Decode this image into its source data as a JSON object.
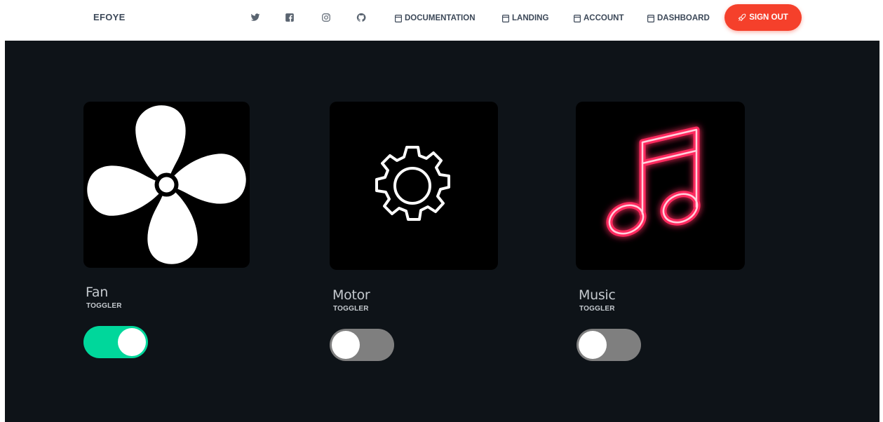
{
  "navbar": {
    "brand": "EFOYE",
    "social": [
      {
        "icon": "twitter-icon"
      },
      {
        "icon": "facebook-icon"
      },
      {
        "icon": "instagram-icon"
      },
      {
        "icon": "github-icon"
      }
    ],
    "links": [
      {
        "label": "DOCUMENTATION",
        "icon": "page-icon"
      },
      {
        "label": "LANDING",
        "icon": "page-icon"
      },
      {
        "label": "ACCOUNT",
        "icon": "page-icon"
      },
      {
        "label": "DASHBOARD",
        "icon": "page-icon"
      }
    ],
    "signout": {
      "label": "SIGN OUT",
      "icon": "rocket-icon",
      "color": "#f5402b"
    }
  },
  "devices": [
    {
      "name": "Fan",
      "subtitle": "TOGGLER",
      "icon": "fan-icon",
      "on": true
    },
    {
      "name": "Motor",
      "subtitle": "TOGGLER",
      "icon": "gear-icon",
      "on": false
    },
    {
      "name": "Music",
      "subtitle": "TOGGLER",
      "icon": "music-note-icon",
      "on": false
    }
  ],
  "colors": {
    "background": "#0e1318",
    "toggle_on": "#00d79b",
    "toggle_off": "#7f7f7f",
    "neon": "#ff2a5f"
  }
}
